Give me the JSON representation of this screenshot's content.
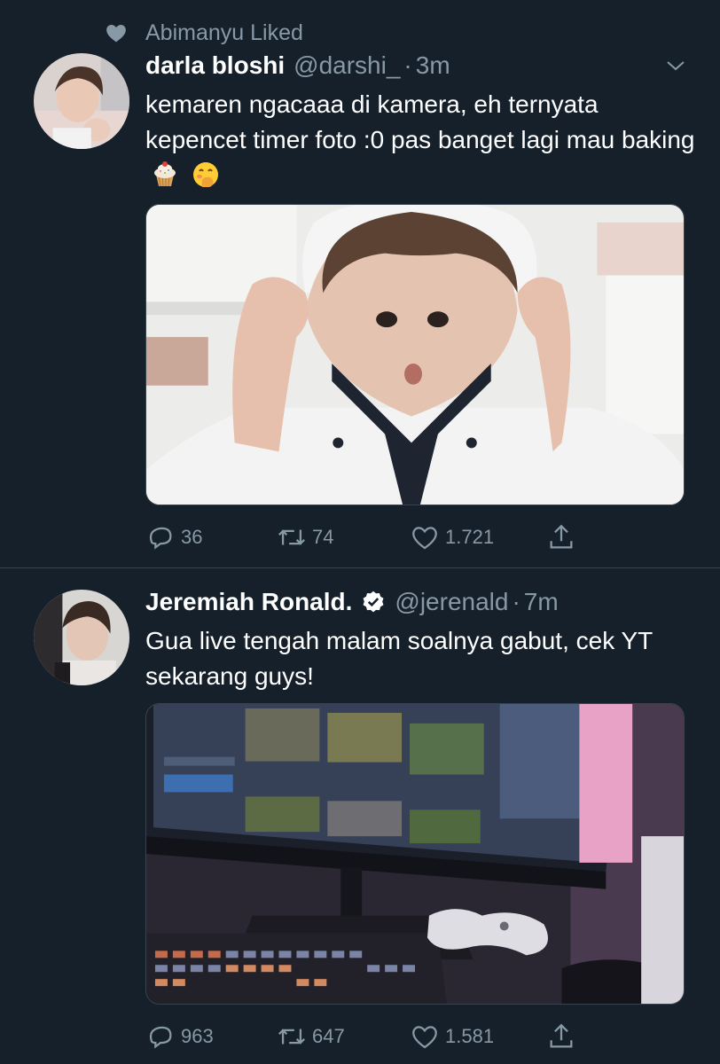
{
  "tweets": [
    {
      "social_context": "Abimanyu Liked",
      "name": "darla bloshi",
      "handle": "@darshi_",
      "time": "3m",
      "verified": false,
      "text": "kemaren ngacaaa di kamera, eh ternyata kepencet timer foto :0 pas banget lagi mau baking",
      "emojis": [
        "cupcake-emoji",
        "hand-over-mouth-emoji"
      ],
      "replies": "36",
      "retweets": "74",
      "likes": "1.721"
    },
    {
      "name": "Jeremiah Ronald.",
      "handle": "@jerenald",
      "time": "7m",
      "verified": true,
      "text": "Gua live tengah malam soalnya gabut, cek YT sekarang guys!",
      "replies": "963",
      "retweets": "647",
      "likes": "1.581"
    }
  ],
  "separator": "·",
  "colors": {
    "background": "#15202b",
    "muted": "#8899a6",
    "divider": "#38444d",
    "verified": "#ffffff"
  }
}
